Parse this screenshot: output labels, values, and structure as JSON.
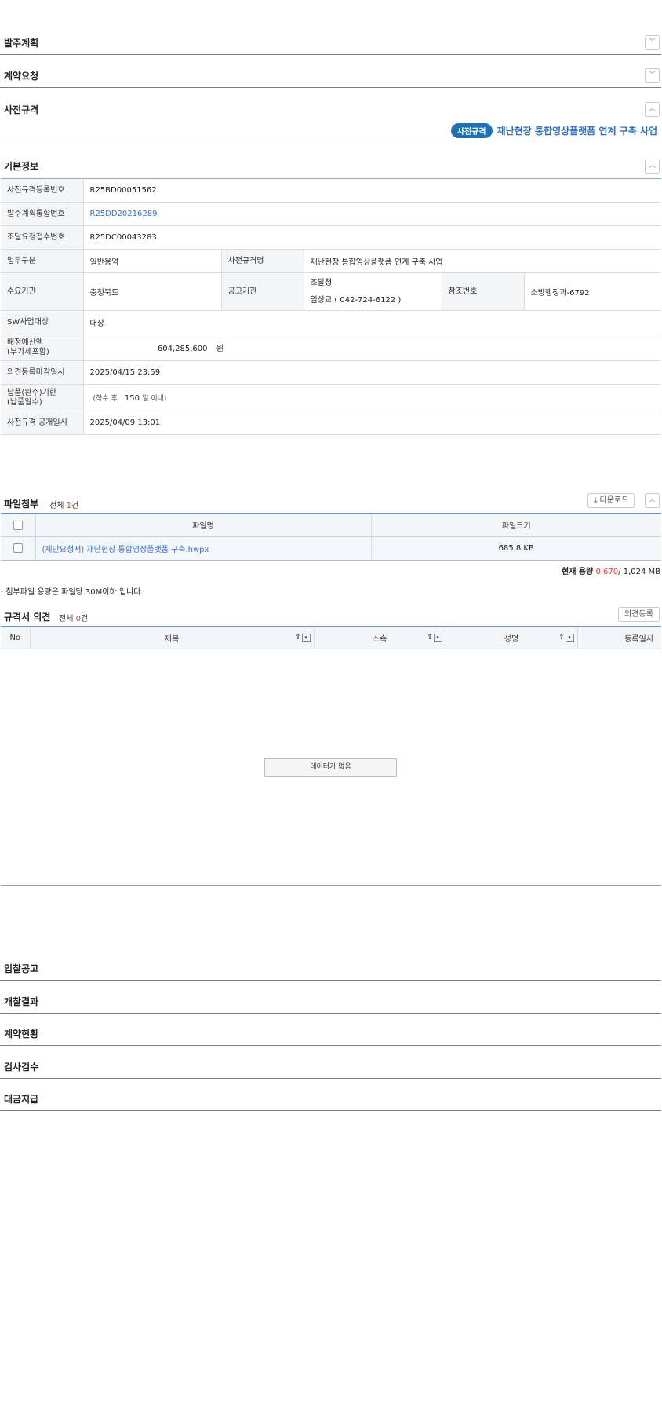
{
  "sections_top": [
    {
      "title": "발주계획",
      "icon": "chevron-down-icon"
    },
    {
      "title": "계약요청",
      "icon": "chevron-down-icon"
    },
    {
      "title": "사전규격",
      "icon": "chevron-up-icon"
    }
  ],
  "pre_spec": {
    "badge": "사전규격",
    "project_name": "재난현장 통합영상플랫폼 연계 구축 사업"
  },
  "basic_info": {
    "title": "기본정보",
    "rows": {
      "reg_no_label": "사전규격등록번호",
      "reg_no": "R25BD00051562",
      "plan_no_label": "발주계획통합번호",
      "plan_no": "R25DD20216289",
      "req_no_label": "조달요청접수번호",
      "req_no": "R25DC00043283",
      "biz_type_label": "업무구분",
      "biz_type": "일반용역",
      "spec_name_label": "사전규격명",
      "spec_name": "재난현장 통합영상플랫폼 연계 구축 사업",
      "demand_org_label": "수요기관",
      "demand_org": "충청북도",
      "notice_org_label": "공고기관",
      "notice_org": "조달청",
      "notice_contact": "임상교 ( 042-724-6122 )",
      "ref_no_label": "참조번호",
      "ref_no": "소방행정과-6792",
      "sw_label": "SW사업대상",
      "sw": "대상",
      "budget_label_1": "배정예산액",
      "budget_label_2": "(부가세포함)",
      "budget": "604,285,600",
      "budget_unit": "원",
      "deadline_label": "의견등록마감일시",
      "deadline": "2025/04/15 23:59",
      "delivery_label_1": "납품(완수)기한",
      "delivery_label_2": "(납품일수)",
      "delivery_prefix": "(착수 후",
      "delivery_days": "150",
      "delivery_suffix": "일 이내)",
      "open_date_label": "사전규격 공개일시",
      "open_date": "2025/04/09 13:01"
    }
  },
  "files": {
    "title": "파일첨부",
    "count_prefix": "전체",
    "count": "1",
    "count_suffix": "건",
    "download_label": "다운로드",
    "col_name": "파일명",
    "col_size": "파일크기",
    "rows": [
      {
        "name": "(제안요청서) 재난현장 통합영상플랫폼 구축.hwpx",
        "size": "685.8 KB"
      }
    ],
    "usage_label": "현재 용량",
    "usage_value": "0.670",
    "usage_total": "/ 1,024 MB",
    "note": "· 첨부파일 용량은 파일당 30M이하 입니다."
  },
  "opinions": {
    "title": "규격서 의견",
    "count_prefix": "전체",
    "count": "0",
    "count_suffix": "건",
    "register_label": "의견등록",
    "columns": [
      "No",
      "제목",
      "소속",
      "성명",
      "등록일시"
    ],
    "empty": "데이터가 없음"
  },
  "sections_bottom": [
    {
      "title": "입찰공고"
    },
    {
      "title": "개찰결과"
    },
    {
      "title": "계약현황"
    },
    {
      "title": "검사검수"
    },
    {
      "title": "대금지급"
    }
  ]
}
